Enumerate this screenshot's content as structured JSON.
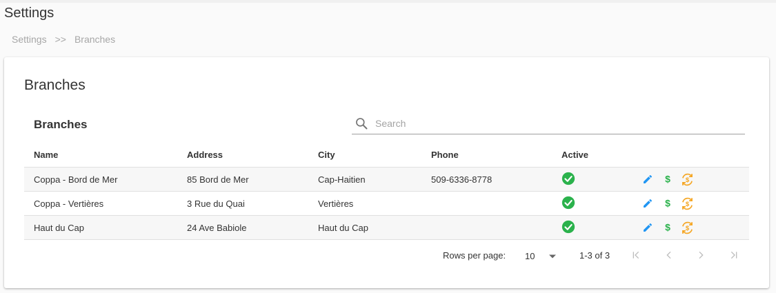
{
  "header": {
    "title": "Settings",
    "breadcrumb": [
      "Settings",
      ">>",
      "Branches"
    ]
  },
  "card": {
    "title": "Branches",
    "table_title": "Branches",
    "search_placeholder": "Search",
    "columns": [
      "Name",
      "Address",
      "City",
      "Phone",
      "Active"
    ],
    "rows": [
      {
        "name": "Coppa - Bord de Mer",
        "address": "85 Bord de Mer",
        "city": "Cap-Haitien",
        "phone": "509-6336-8778",
        "active": true
      },
      {
        "name": "Coppa - Vertières",
        "address": "3 Rue du Quai",
        "city": "Vertières",
        "phone": "",
        "active": true
      },
      {
        "name": "Haut du Cap",
        "address": "24 Ave Babiole",
        "city": "Haut du Cap",
        "phone": "",
        "active": true
      }
    ],
    "row_actions": [
      "edit-icon",
      "dollar-icon",
      "currency-exchange-icon"
    ],
    "pagination": {
      "rows_per_page_label": "Rows per page:",
      "rows_per_page": "10",
      "range": "1-3 of 3",
      "buttons": [
        "first-page-icon",
        "prev-page-icon",
        "next-page-icon",
        "last-page-icon"
      ]
    }
  },
  "colors": {
    "active_green": "#2bb24c",
    "edit_blue": "#2196f3",
    "dollar_green": "#2bb24c",
    "exchange_orange": "#f5a623",
    "disabled_gray": "#bdbdbd"
  }
}
